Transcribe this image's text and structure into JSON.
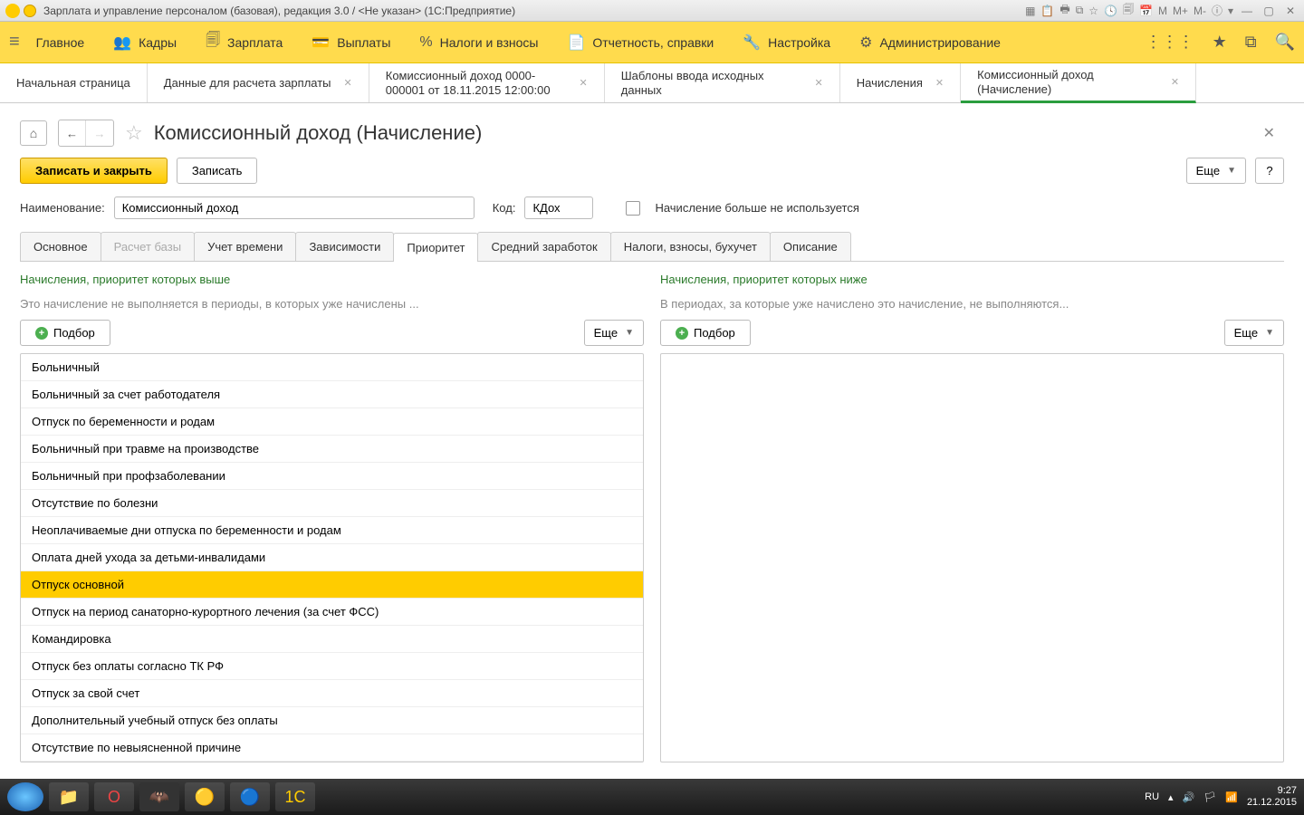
{
  "titlebar": {
    "title": "Зарплата и управление персоналом (базовая), редакция 3.0 / <Не указан>  (1С:Предприятие)",
    "icons_m1": "M",
    "icons_m2": "M+",
    "icons_m3": "M-"
  },
  "mainmenu": {
    "items": [
      {
        "icon": "≡",
        "label": "Главное"
      },
      {
        "icon": "👥",
        "label": "Кадры"
      },
      {
        "icon": "🗐",
        "label": "Зарплата"
      },
      {
        "icon": "💳",
        "label": "Выплаты"
      },
      {
        "icon": "%",
        "label": "Налоги и взносы"
      },
      {
        "icon": "📄",
        "label": "Отчетность, справки"
      },
      {
        "icon": "🔧",
        "label": "Настройка"
      },
      {
        "icon": "⚙",
        "label": "Администрирование"
      }
    ]
  },
  "tabs": [
    {
      "label": "Начальная страница",
      "closable": false,
      "active": false
    },
    {
      "label": "Данные для расчета зарплаты",
      "closable": true,
      "active": false
    },
    {
      "label": "Комиссионный доход 0000-000001 от 18.11.2015 12:00:00",
      "closable": true,
      "active": false
    },
    {
      "label": "Шаблоны ввода исходных данных",
      "closable": true,
      "active": false
    },
    {
      "label": "Начисления",
      "closable": true,
      "active": false
    },
    {
      "label": "Комиссионный доход (Начисление)",
      "closable": true,
      "active": true
    }
  ],
  "page": {
    "title": "Комиссионный доход (Начисление)",
    "save_close": "Записать и закрыть",
    "save": "Записать",
    "more": "Еще",
    "help": "?"
  },
  "form": {
    "name_label": "Наименование:",
    "name_value": "Комиссионный доход",
    "code_label": "Код:",
    "code_value": "КДох",
    "nouse_label": "Начисление больше не используется"
  },
  "inner_tabs": [
    {
      "label": "Основное",
      "state": "normal"
    },
    {
      "label": "Расчет базы",
      "state": "disabled"
    },
    {
      "label": "Учет времени",
      "state": "normal"
    },
    {
      "label": "Зависимости",
      "state": "normal"
    },
    {
      "label": "Приоритет",
      "state": "active"
    },
    {
      "label": "Средний заработок",
      "state": "normal"
    },
    {
      "label": "Налоги, взносы, бухучет",
      "state": "normal"
    },
    {
      "label": "Описание",
      "state": "normal"
    }
  ],
  "priority": {
    "left": {
      "head": "Начисления, приоритет которых выше",
      "sub": "Это начисление не выполняется в периоды, в которых уже начислены ...",
      "pick": "Подбор",
      "more": "Еще",
      "items": [
        "Больничный",
        "Больничный за счет работодателя",
        "Отпуск по беременности и родам",
        "Больничный при травме на производстве",
        "Больничный при профзаболевании",
        "Отсутствие по болезни",
        "Неоплачиваемые дни отпуска по беременности и родам",
        "Оплата дней ухода за детьми-инвалидами",
        "Отпуск основной",
        "Отпуск на период санаторно-курортного лечения (за счет ФСС)",
        "Командировка",
        "Отпуск без оплаты согласно ТК РФ",
        "Отпуск за свой счет",
        "Дополнительный учебный отпуск без оплаты",
        "Отсутствие по невыясненной причине"
      ],
      "selected_index": 8
    },
    "right": {
      "head": "Начисления, приоритет которых ниже",
      "sub": "В периодах, за которые уже начислено это начисление, не выполняются...",
      "pick": "Подбор",
      "more": "Еще",
      "items": []
    }
  },
  "taskbar": {
    "lang": "RU",
    "time": "9:27",
    "date": "21.12.2015"
  }
}
